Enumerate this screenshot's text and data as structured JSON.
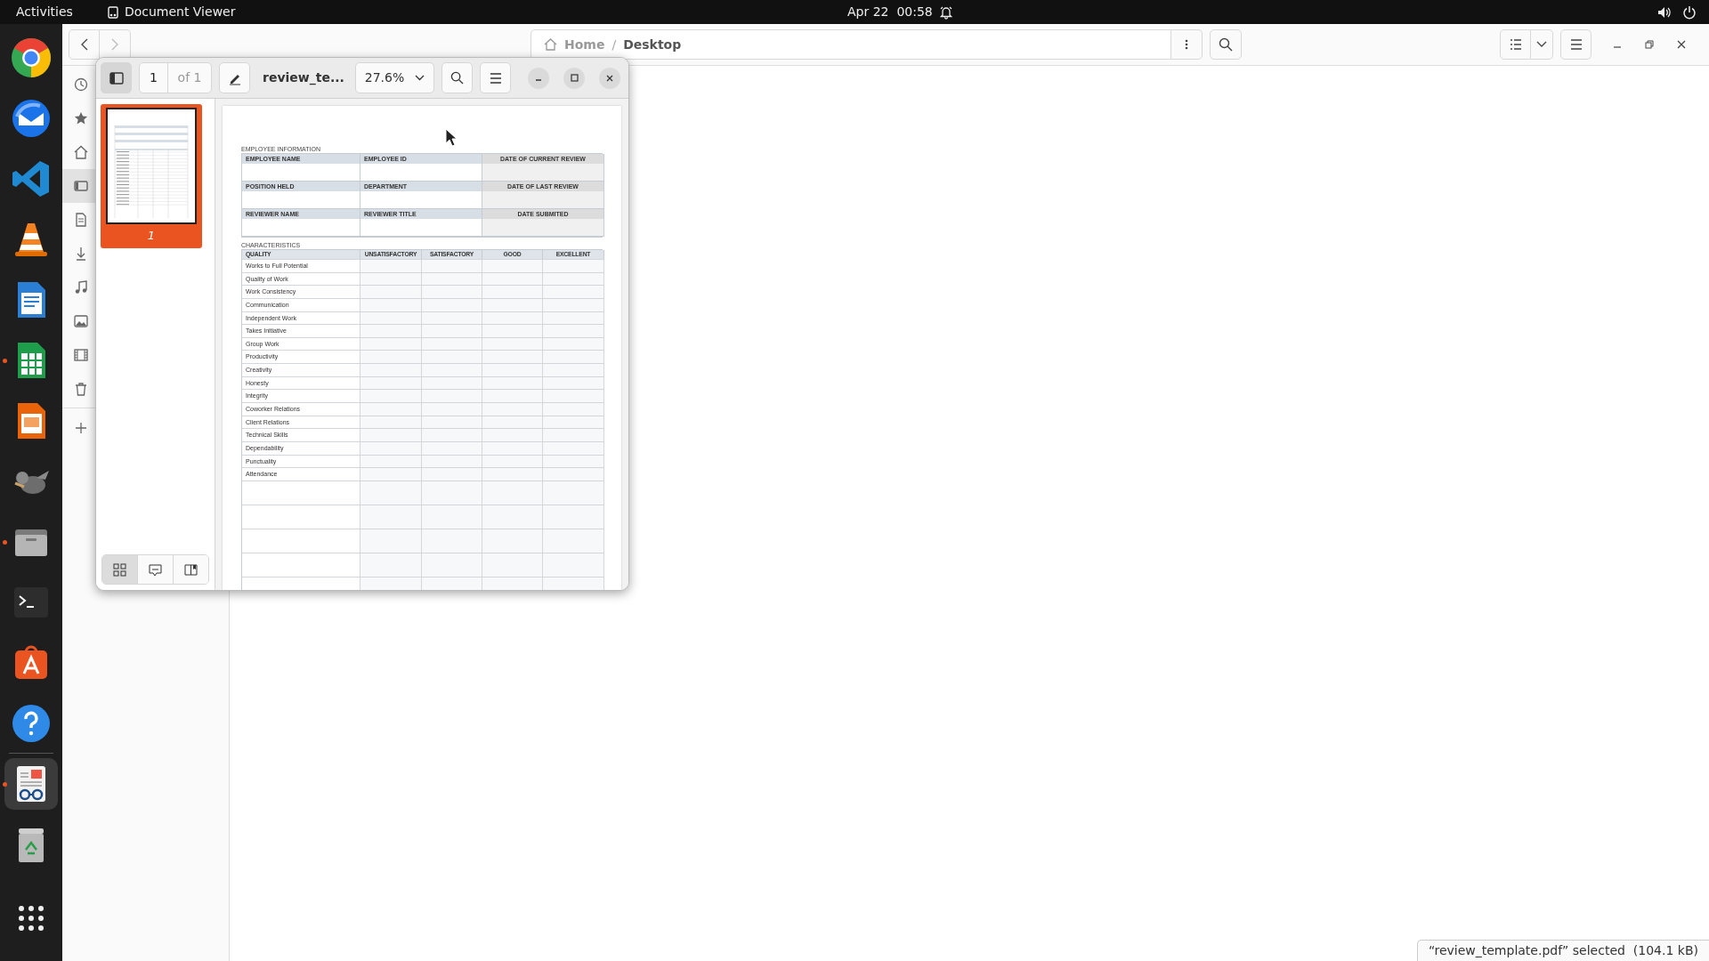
{
  "top_bar": {
    "activities": "Activities",
    "app_name": "Document Viewer",
    "clock": "Apr 22  00:58"
  },
  "dock": [
    {
      "kind": "chrome",
      "running": false,
      "selected": false
    },
    {
      "kind": "thunderbird",
      "running": false,
      "selected": false
    },
    {
      "kind": "vscode",
      "running": false,
      "selected": false
    },
    {
      "kind": "vlc",
      "running": false,
      "selected": false
    },
    {
      "kind": "writer",
      "running": false,
      "selected": false
    },
    {
      "kind": "calc",
      "running": true,
      "selected": false
    },
    {
      "kind": "impress",
      "running": false,
      "selected": false
    },
    {
      "kind": "gimp",
      "running": false,
      "selected": false
    },
    {
      "kind": "files",
      "running": true,
      "selected": false
    },
    {
      "kind": "terminal",
      "running": false,
      "selected": false
    },
    {
      "kind": "store",
      "running": false,
      "selected": false
    },
    {
      "kind": "help",
      "running": false,
      "selected": false
    },
    {
      "kind": "viewer",
      "running": true,
      "selected": true
    },
    {
      "kind": "trash",
      "running": false,
      "selected": false
    }
  ],
  "file_manager": {
    "path_separator": "/",
    "path": [
      {
        "label": "Home",
        "kind": "home"
      },
      {
        "label": "Desktop",
        "kind": "folder"
      }
    ],
    "sidebar": [
      {
        "kind": "recent",
        "selected": false
      },
      {
        "kind": "starred",
        "selected": false
      },
      {
        "kind": "home",
        "selected": false
      },
      {
        "kind": "desktop",
        "selected": true
      },
      {
        "kind": "documents",
        "selected": false
      },
      {
        "kind": "downloads",
        "selected": false
      },
      {
        "kind": "music",
        "selected": false
      },
      {
        "kind": "pictures",
        "selected": false
      },
      {
        "kind": "videos",
        "selected": false
      },
      {
        "kind": "trash",
        "selected": false
      },
      {
        "kind": "add",
        "selected": false
      }
    ],
    "status": "“review_template.pdf” selected  (104.1 kB)"
  },
  "viewer": {
    "page": "1",
    "page_count": "of 1",
    "title": "review_te...",
    "zoom": "27.6%",
    "thumbnails": [
      {
        "label": "1",
        "selected": true
      }
    ],
    "sidebar_modes": [
      {
        "kind": "thumbnails",
        "selected": true
      },
      {
        "kind": "annotations",
        "selected": false
      },
      {
        "kind": "bookmarks",
        "selected": false
      }
    ],
    "document": {
      "section_1": "EMPLOYEE INFORMATION",
      "fields": [
        [
          {
            "label": "EMPLOYEE NAME",
            "shaded": false
          },
          {
            "label": "EMPLOYEE ID",
            "shaded": false
          },
          {
            "label": "DATE OF CURRENT REVIEW",
            "shaded": true
          }
        ],
        [
          {
            "label": "POSITION HELD",
            "shaded": false
          },
          {
            "label": "DEPARTMENT",
            "shaded": false
          },
          {
            "label": "DATE OF LAST REVIEW",
            "shaded": true
          }
        ],
        [
          {
            "label": "REVIEWER NAME",
            "shaded": false
          },
          {
            "label": "REVIEWER TITLE",
            "shaded": false
          },
          {
            "label": "DATE SUBMITED",
            "shaded": true
          }
        ]
      ],
      "section_2": "CHARACTERISTICS",
      "columns": [
        "QUALITY",
        "UNSATISFACTORY",
        "SATISFACTORY",
        "GOOD",
        "EXCELLENT"
      ],
      "qualities": [
        "Works to Full Potential",
        "Quality of Work",
        "Work Consistency",
        "Communication",
        "Independent Work",
        "Takes Initiative",
        "Group Work",
        "Productivity",
        "Creativity",
        "Honesty",
        "Integrity",
        "Coworker Relations",
        "Client Relations",
        "Technical Skills",
        "Dependability",
        "Punctuality",
        "Attendance"
      ]
    }
  }
}
